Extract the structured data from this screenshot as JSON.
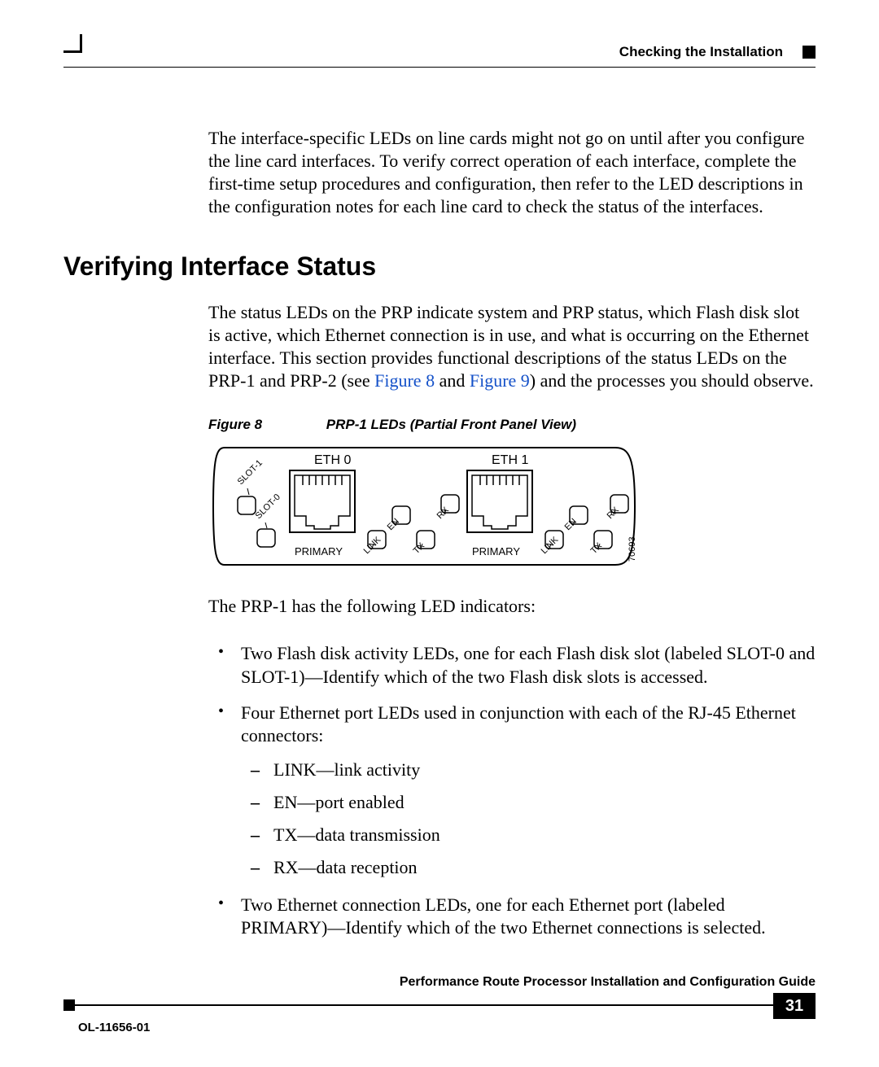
{
  "header": {
    "running_head": "Checking the Installation"
  },
  "intro_para": "The interface-specific LEDs on line cards might not go on until after you configure the line card interfaces. To verify correct operation of each interface, complete the first-time setup procedures and configuration, then refer to the LED descriptions in the configuration notes for each line card to check the status of the interfaces.",
  "section_title": "Verifying Interface Status",
  "status_para_before": "The status LEDs on the PRP indicate system and PRP status, which Flash disk slot is active, which Ethernet connection is in use, and what is occurring on the Ethernet interface. This section provides functional descriptions of the status LEDs on the PRP-1 and PRP-2 (see ",
  "fig8_ref": "Figure 8",
  "status_and": " and ",
  "fig9_ref": "Figure 9",
  "status_para_after": ") and the processes you should observe.",
  "figure": {
    "num": "Figure 8",
    "title": "PRP-1 LEDs (Partial Front Panel View)",
    "labels": {
      "eth0": "ETH 0",
      "eth1": "ETH 1",
      "primary": "PRIMARY",
      "slot1": "SLOT-1",
      "slot0": "SLOT-0",
      "link": "LINK",
      "en": "EN",
      "tx": "TX",
      "rx": "RX",
      "artnum": "70693"
    }
  },
  "prp1_intro": "The PRP-1 has the following LED indicators:",
  "bullets": {
    "b1": "Two Flash disk activity LEDs, one for each Flash disk slot (labeled SLOT-0 and SLOT-1)—Identify which of the two Flash disk slots is accessed.",
    "b2": "Four Ethernet port LEDs used in conjunction with each of the RJ-45 Ethernet connectors:",
    "b2_sub": {
      "s1": "LINK—link activity",
      "s2": "EN—port enabled",
      "s3": "TX—data transmission",
      "s4": "RX—data reception"
    },
    "b3": "Two Ethernet connection LEDs, one for each Ethernet port (labeled PRIMARY)—Identify which of the two Ethernet connections is selected."
  },
  "footer": {
    "title": "Performance Route Processor Installation and Configuration Guide",
    "docid": "OL-11656-01",
    "page": "31"
  }
}
